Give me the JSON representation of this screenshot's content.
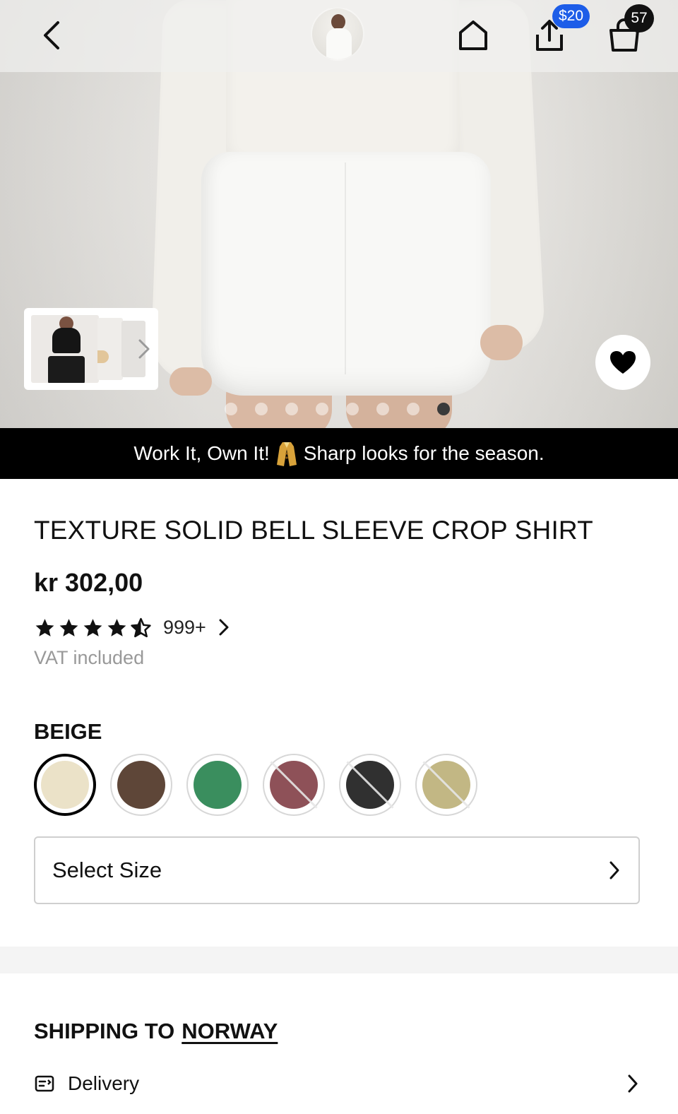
{
  "header": {
    "back_icon": "chevron-left-icon",
    "home_icon": "home-icon",
    "share_icon": "share-icon",
    "bag_icon": "shopping-bag-icon",
    "share_badge": "$20",
    "bag_count": "57"
  },
  "gallery": {
    "total_images": 8,
    "active_index": 7,
    "favorite_icon": "heart-icon"
  },
  "promo": {
    "text_before": "Work It, Own It!",
    "text_after": "Sharp looks for the season."
  },
  "product": {
    "title": "TEXTURE SOLID BELL SLEEVE CROP SHIRT",
    "price": "kr 302,00",
    "rating": 4.5,
    "rating_count": "999+",
    "vat": "VAT included",
    "selected_color": "BEIGE",
    "colors": [
      {
        "hex": "#ebe2c8",
        "selected": true,
        "available": true
      },
      {
        "hex": "#5e4638",
        "selected": false,
        "available": true
      },
      {
        "hex": "#3a8e5e",
        "selected": false,
        "available": true
      },
      {
        "hex": "#8e5158",
        "selected": false,
        "available": false
      },
      {
        "hex": "#303030",
        "selected": false,
        "available": false
      },
      {
        "hex": "#c2b784",
        "selected": false,
        "available": false
      }
    ],
    "size_label": "Select Size"
  },
  "shipping": {
    "prefix": "SHIPPING TO",
    "country": "NORWAY",
    "delivery_label": "Delivery"
  },
  "colors": {
    "accent_blue": "#1d5de8",
    "black": "#000000",
    "muted_text": "#999999"
  }
}
